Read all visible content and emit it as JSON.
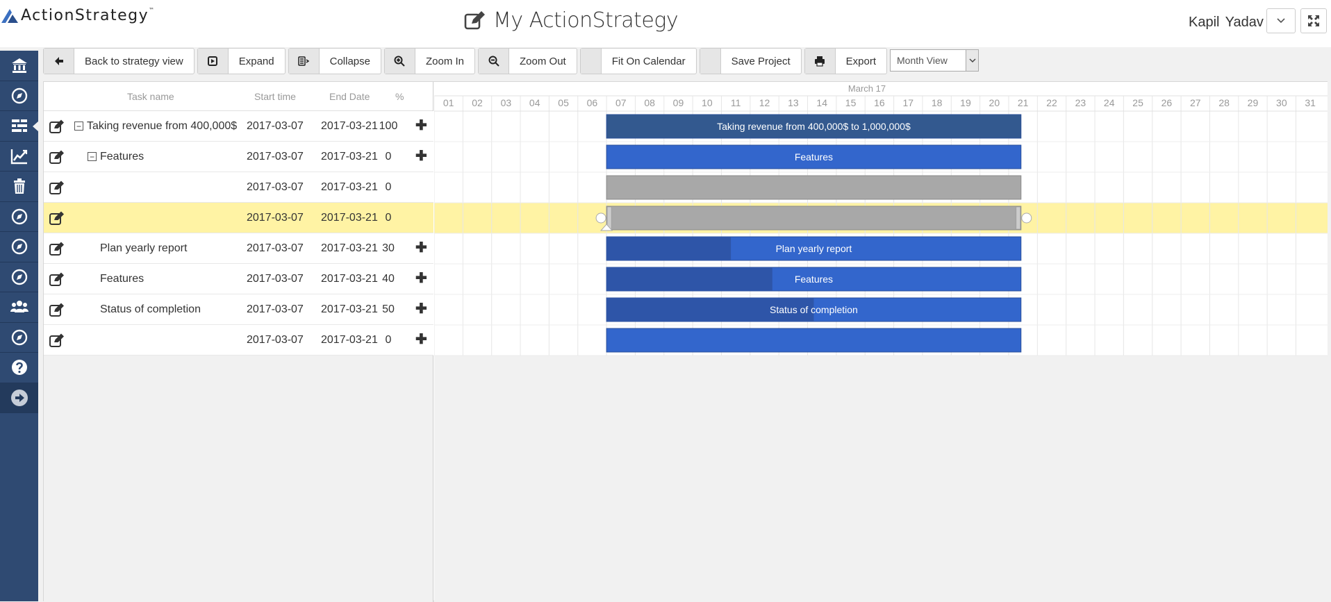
{
  "app": {
    "logo_text": "ActionStrategy",
    "logo_tm": "™",
    "page_title": "My ActionStrategy",
    "user_name": "Kapil Yadav"
  },
  "sidebar": {
    "items": [
      {
        "icon": "bank-icon"
      },
      {
        "icon": "compass-icon"
      },
      {
        "icon": "gantt-icon",
        "active": true
      },
      {
        "icon": "line-chart-icon"
      },
      {
        "icon": "trash-icon"
      },
      {
        "icon": "compass-icon"
      },
      {
        "icon": "compass-icon"
      },
      {
        "icon": "compass-icon"
      },
      {
        "icon": "users-icon"
      },
      {
        "icon": "compass-icon"
      },
      {
        "icon": "help-icon"
      },
      {
        "icon": "arrow-right-circle-icon"
      }
    ]
  },
  "toolbar": {
    "back": "Back to strategy view",
    "expand": "Expand",
    "collapse": "Collapse",
    "zoom_in": "Zoom In",
    "zoom_out": "Zoom Out",
    "fit": "Fit On Calendar",
    "save": "Save Project",
    "export": "Export",
    "view_select": "Month View"
  },
  "grid": {
    "columns": {
      "task": "Task name",
      "start": "Start time",
      "end": "End Date",
      "pct": "%"
    },
    "rows": [
      {
        "name": "Taking revenue from 400,000$",
        "start": "2017-03-07",
        "end": "2017-03-21",
        "pct": "100",
        "level": 0,
        "toggle": "−",
        "add": "✚",
        "bar_text": "Taking revenue from 400,000$ to 1,000,000$",
        "bar_color": "#33598f",
        "progress": 1.0,
        "highlight": false
      },
      {
        "name": "Features",
        "start": "2017-03-07",
        "end": "2017-03-21",
        "pct": "0",
        "level": 1,
        "toggle": "−",
        "add": "✚",
        "bar_text": "Features",
        "bar_color": "#3366cc",
        "progress": 0,
        "highlight": false
      },
      {
        "name": "",
        "start": "2017-03-07",
        "end": "2017-03-21",
        "pct": "0",
        "level": 2,
        "toggle": "",
        "add": "",
        "bar_text": "",
        "bar_color": "#a8a8a8",
        "progress": 0,
        "highlight": false
      },
      {
        "name": "",
        "start": "2017-03-07",
        "end": "2017-03-21",
        "pct": "0",
        "level": 2,
        "toggle": "",
        "add": "",
        "bar_text": "",
        "bar_color": "#a8a8a8",
        "progress": 0,
        "highlight": true
      },
      {
        "name": "Plan yearly report",
        "start": "2017-03-07",
        "end": "2017-03-21",
        "pct": "30",
        "level": 2,
        "toggle": "",
        "add": "✚",
        "bar_text": "Plan yearly report",
        "bar_color": "#3366cc",
        "progress": 0.3,
        "highlight": false
      },
      {
        "name": "Features",
        "start": "2017-03-07",
        "end": "2017-03-21",
        "pct": "40",
        "level": 2,
        "toggle": "",
        "add": "✚",
        "bar_text": "Features",
        "bar_color": "#3366cc",
        "progress": 0.4,
        "highlight": false
      },
      {
        "name": "Status of completion",
        "start": "2017-03-07",
        "end": "2017-03-21",
        "pct": "50",
        "level": 2,
        "toggle": "",
        "add": "✚",
        "bar_text": "Status of completion",
        "bar_color": "#3366cc",
        "progress": 0.5,
        "highlight": false
      },
      {
        "name": "",
        "start": "2017-03-07",
        "end": "2017-03-21",
        "pct": "0",
        "level": 2,
        "toggle": "",
        "add": "✚",
        "bar_text": "",
        "bar_color": "#3366cc",
        "progress": 0,
        "highlight": false
      }
    ]
  },
  "timeline": {
    "month_label": "March 17",
    "days": [
      "01",
      "02",
      "03",
      "04",
      "05",
      "06",
      "07",
      "08",
      "09",
      "10",
      "11",
      "12",
      "13",
      "14",
      "15",
      "16",
      "17",
      "18",
      "19",
      "20",
      "21",
      "22",
      "23",
      "24",
      "25",
      "26",
      "27",
      "28",
      "29",
      "30",
      "31"
    ],
    "bar_start_day": 7,
    "bar_end_day": 21
  },
  "colors": {
    "sidebar": "#2f4a72",
    "highlight_row": "#fff3a4",
    "progress_fill": "#2e55a8"
  }
}
